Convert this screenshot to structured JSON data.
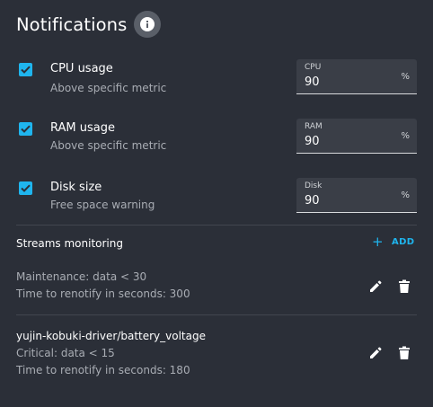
{
  "header": {
    "title": "Notifications",
    "info_icon": "info-icon"
  },
  "metrics": [
    {
      "checked": true,
      "title": "CPU usage",
      "subtitle": "Above specific metric",
      "field_label": "CPU",
      "field_value": "90",
      "unit": "%"
    },
    {
      "checked": true,
      "title": "RAM usage",
      "subtitle": "Above specific metric",
      "field_label": "RAM",
      "field_value": "90",
      "unit": "%"
    },
    {
      "checked": true,
      "title": "Disk size",
      "subtitle": "Free space warning",
      "field_label": "Disk",
      "field_value": "90",
      "unit": "%"
    }
  ],
  "streams": {
    "title": "Streams monitoring",
    "add_label": "ADD",
    "add_icon": "plus-icon",
    "items": [
      {
        "name": "",
        "lines": [
          "Maintenance: data < 30",
          "Time to renotify in seconds: 300"
        ],
        "edit_icon": "pencil-icon",
        "delete_icon": "trash-icon"
      },
      {
        "name": "yujin-kobuki-driver/battery_voltage",
        "lines": [
          "Critical: data < 15",
          "Time to renotify in seconds: 180"
        ],
        "edit_icon": "pencil-icon",
        "delete_icon": "trash-icon"
      }
    ]
  },
  "colors": {
    "background": "#2b2f38",
    "accent": "#1fb5ee",
    "field_bg": "#3a3e47",
    "muted_text": "#a9adb4",
    "divider": "#42464f"
  }
}
